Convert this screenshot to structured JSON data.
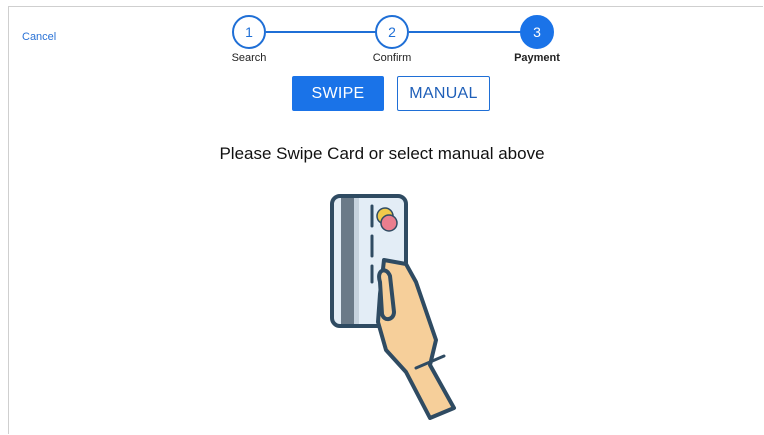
{
  "header": {
    "cancel_label": "Cancel"
  },
  "stepper": {
    "steps": [
      {
        "number": "1",
        "label": "Search",
        "state": "complete"
      },
      {
        "number": "2",
        "label": "Confirm",
        "state": "complete"
      },
      {
        "number": "3",
        "label": "Payment",
        "state": "current"
      }
    ],
    "accent_color": "#1a73e8"
  },
  "payment_mode": {
    "swipe_label": "SWIPE",
    "manual_label": "MANUAL",
    "selected": "SWIPE"
  },
  "main": {
    "prompt": "Please Swipe Card or select manual above",
    "illustration": "hand-holding-card-icon"
  }
}
